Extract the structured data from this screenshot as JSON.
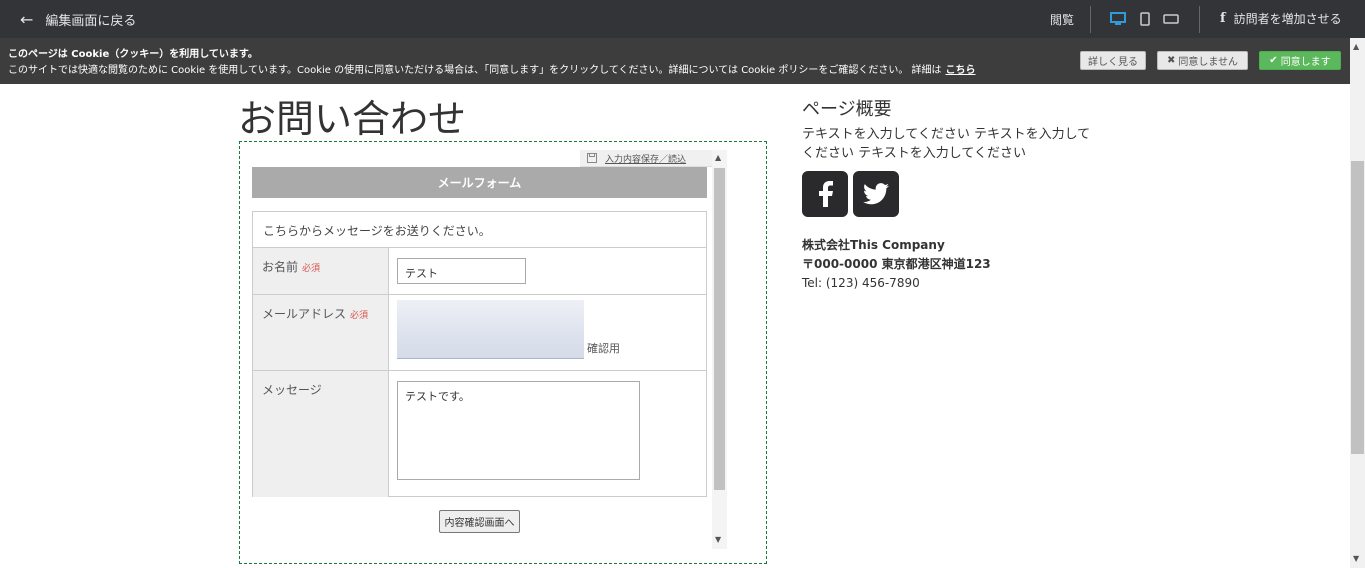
{
  "topbar": {
    "back_label": "編集画面に戻る",
    "view_label": "閲覧",
    "fb_label": "訪問者を増加させる"
  },
  "cookie": {
    "title": "このページは Cookie（クッキー）を利用しています。",
    "text": "このサイトでは快適な閲覧のために Cookie を使用しています。Cookie の使用に同意いただける場合は、「同意します」をクリックしてください。詳細については Cookie ポリシーをご確認ください。 詳細は",
    "link": "こちら",
    "detail_button": "詳しく見る",
    "deny_button": "同意しません",
    "agree_button": "同意します"
  },
  "page": {
    "title": "お問い合わせ"
  },
  "form": {
    "save_link": "入力内容保存／読込",
    "header": "メールフォーム",
    "intro": "こちらからメッセージをお送りください。",
    "name_label": "お名前",
    "required": "必須",
    "name_value": "テスト",
    "email_label": "メールアドレス",
    "email_confirm": "確認用",
    "message_label": "メッセージ",
    "message_value": "テストです。",
    "submit": "内容確認画面へ"
  },
  "sidebar": {
    "title": "ページ概要",
    "text": "テキストを入力してください テキストを入力してください テキストを入力してください",
    "company_name": "株式会社This Company",
    "address": "〒000-0000 東京都港区神道123",
    "tel": "Tel: (123) 456-7890"
  },
  "colors": {
    "topbar": "#333438",
    "cookiebar": "#3d3d3d",
    "agree": "#5cb85c",
    "required": "#d9534f",
    "active_device": "#2f9bd8"
  }
}
